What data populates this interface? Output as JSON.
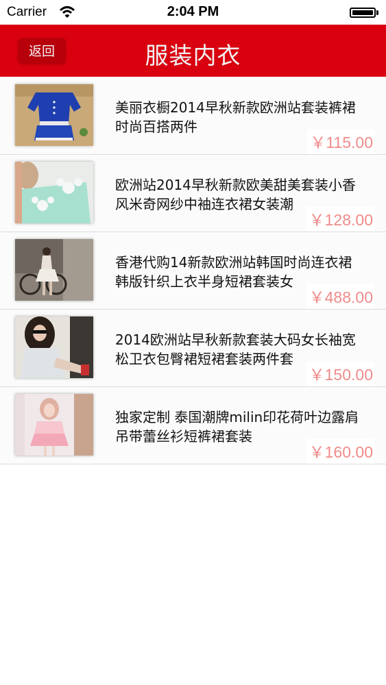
{
  "status": {
    "carrier": "Carrier",
    "time": "2:04 PM"
  },
  "nav": {
    "back_label": "返回",
    "title": "服装内衣"
  },
  "products": [
    {
      "title": "美丽衣橱2014早秋新款欧洲站套装裤裙时尚百搭两件",
      "price": "￥115.00",
      "image": "blue-dress-set"
    },
    {
      "title": "欧洲站2014早秋新款欧美甜美套装小香风米奇网纱中袖连衣裙女装潮",
      "price": "￥128.00",
      "image": "mint-mickey-dress"
    },
    {
      "title": "香港代购14新款欧洲站韩国时尚连衣裙韩版针织上衣半身短裙套装女",
      "price": "￥488.00",
      "image": "model-bicycle"
    },
    {
      "title": "2014欧洲站早秋新款套装大码女长袖宽松卫衣包臀裙短裙套装两件套",
      "price": "￥150.00",
      "image": "model-sunglasses"
    },
    {
      "title": "独家定制 泰国潮牌milin印花荷叶边露肩吊带蕾丝衫短裤裙套装",
      "price": "￥160.00",
      "image": "pink-lace-set"
    }
  ]
}
